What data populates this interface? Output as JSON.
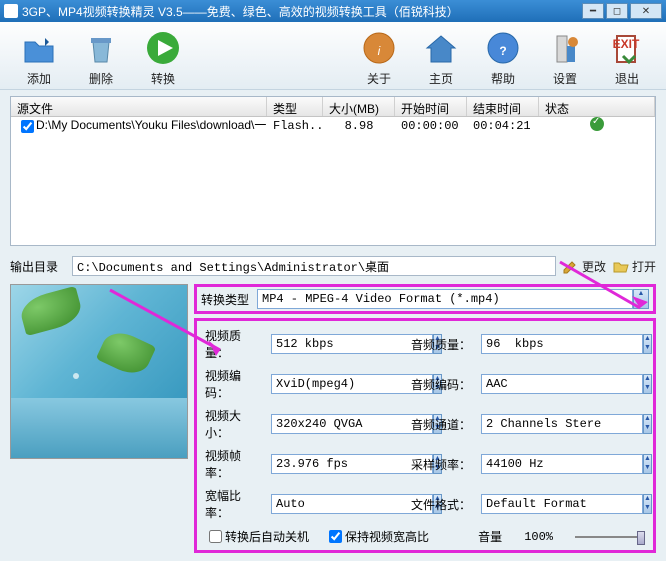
{
  "window": {
    "title": "3GP、MP4视频转换精灵 V3.5——免费、绿色、高效的视频转换工具（佰锐科技）"
  },
  "toolbar": {
    "add": "添加",
    "delete": "删除",
    "convert": "转换",
    "about": "关于",
    "home": "主页",
    "help": "帮助",
    "settings": "设置",
    "exit": "退出"
  },
  "table": {
    "headers": {
      "source": "源文件",
      "type": "类型",
      "size": "大小(MB)",
      "start": "开始时间",
      "end": "结束时间",
      "status": "状态"
    },
    "rows": [
      {
        "checked": true,
        "source": "D:\\My Documents\\Youku Files\\download\\一...",
        "type": "Flash...",
        "size": "8.98",
        "start": "00:00:00",
        "end": "00:04:21"
      }
    ]
  },
  "outdir": {
    "label": "输出目录",
    "path": "C:\\Documents and Settings\\Administrator\\桌面",
    "change": "更改",
    "open": "打开"
  },
  "format": {
    "label": "转换类型",
    "value": "MP4 - MPEG-4 Video Format (*.mp4)"
  },
  "params": {
    "video_quality_label": "视频质量：",
    "video_quality": "512 kbps",
    "audio_quality_label": "音频质量：",
    "audio_quality": "96  kbps",
    "video_codec_label": "视频编码：",
    "video_codec": "XviD(mpeg4)",
    "audio_codec_label": "音频编码：",
    "audio_codec": "AAC",
    "video_size_label": "视频大小：",
    "video_size": "320x240 QVGA",
    "audio_channels_label": "音频通道：",
    "audio_channels": "2 Channels Stere",
    "video_fps_label": "视频帧率：",
    "video_fps": "23.976 fps",
    "sample_rate_label": "采样频率：",
    "sample_rate": "44100 Hz",
    "aspect_label": "宽幅比率：",
    "aspect": "Auto",
    "file_format_label": "文件格式：",
    "file_format": "Default Format"
  },
  "checks": {
    "auto_shutdown": "转换后自动关机",
    "keep_aspect": "保持视频宽高比",
    "volume_label": "音量",
    "volume_value": "100%"
  }
}
